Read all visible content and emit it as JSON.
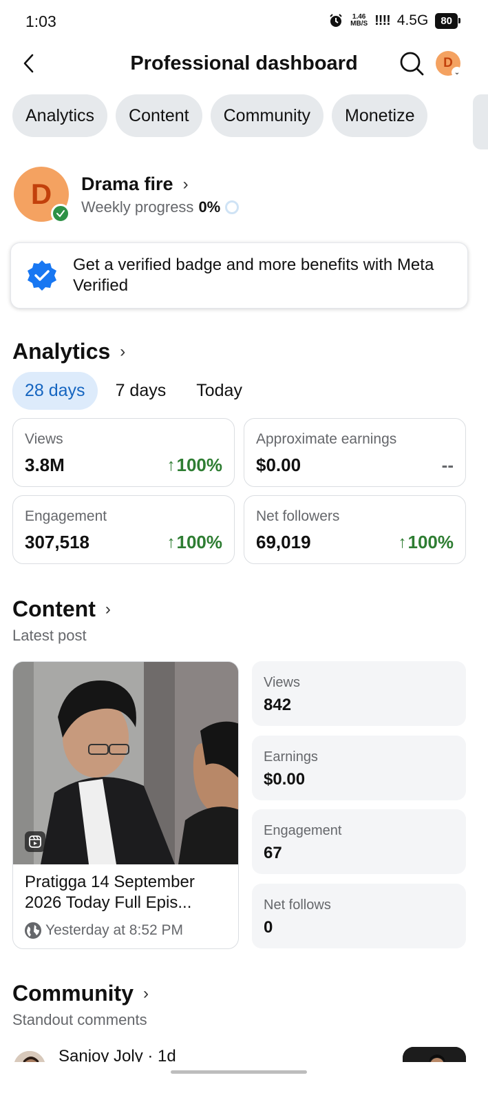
{
  "status_bar": {
    "time": "1:03",
    "speed_top": "1.46",
    "speed_bottom": "MB/S",
    "signal": "!!!!",
    "network": "4.5G",
    "battery": "80"
  },
  "header": {
    "title": "Professional dashboard",
    "back_icon": "chevron-left-icon",
    "search_icon": "search-icon",
    "avatar_letter": "D"
  },
  "tabs": [
    "Analytics",
    "Content",
    "Community",
    "Monetize"
  ],
  "profile": {
    "avatar_letter": "D",
    "name": "Drama fire",
    "progress_label": "Weekly progress",
    "progress_value": "0%"
  },
  "meta_verified": {
    "text": "Get a verified badge and more benefits with Meta Verified",
    "icon": "verified-badge-icon",
    "accent": "#1877f2"
  },
  "analytics": {
    "title": "Analytics",
    "periods": [
      "28 days",
      "7 days",
      "Today"
    ],
    "active_period": "28 days",
    "cards": [
      {
        "label": "Views",
        "value": "3.8M",
        "change": "100%",
        "arrow": "↑"
      },
      {
        "label": "Approximate earnings",
        "value": "$0.00",
        "change": "--",
        "arrow": ""
      },
      {
        "label": "Engagement",
        "value": "307,518",
        "change": "100%",
        "arrow": "↑"
      },
      {
        "label": "Net followers",
        "value": "69,019",
        "change": "100%",
        "arrow": "↑"
      }
    ],
    "positive_color": "#2e7d32"
  },
  "content": {
    "title": "Content",
    "subtitle": "Latest post",
    "post": {
      "title": "Pratigga 14 September 2026 Today Full Epis...",
      "time": "Yesterday at 8:52 PM",
      "reel_icon": "reel-icon",
      "privacy_icon": "globe-icon"
    },
    "stats": [
      {
        "label": "Views",
        "value": "842"
      },
      {
        "label": "Earnings",
        "value": "$0.00"
      },
      {
        "label": "Engagement",
        "value": "67"
      },
      {
        "label": "Net follows",
        "value": "0"
      }
    ]
  },
  "community": {
    "title": "Community",
    "subtitle": "Standout comments",
    "first_comment": {
      "author": "Sanjoy Joly · 1d"
    }
  }
}
